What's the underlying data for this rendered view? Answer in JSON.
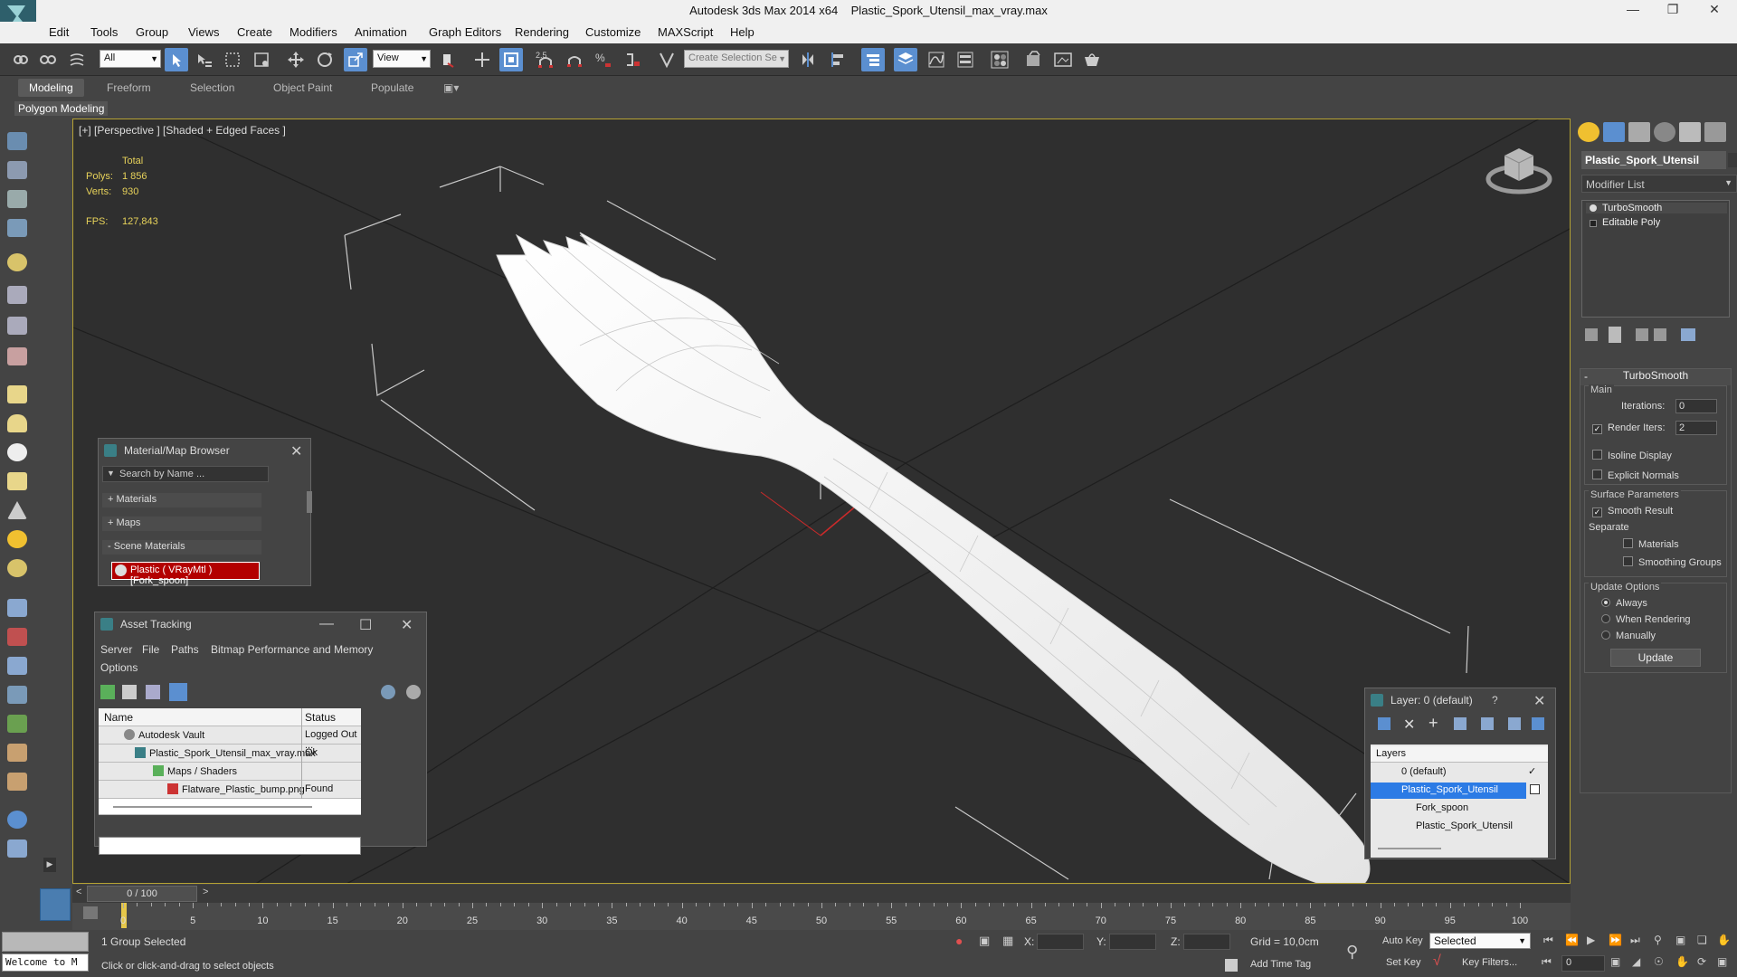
{
  "window": {
    "app_title": "Autodesk 3ds Max  2014 x64",
    "file_title": "Plastic_Spork_Utensil_max_vray.max"
  },
  "menu": [
    "Edit",
    "Tools",
    "Group",
    "Views",
    "Create",
    "Modifiers",
    "Animation",
    "Graph Editors",
    "Rendering",
    "Customize",
    "MAXScript",
    "Help"
  ],
  "toolbar": {
    "selection_filter": "All",
    "reference_coord": "View",
    "snap_label": "2.5",
    "named_selection_placeholder": "Create Selection Se"
  },
  "ribbon": {
    "tabs": [
      "Modeling",
      "Freeform",
      "Selection",
      "Object Paint",
      "Populate"
    ],
    "active_tab": "Modeling",
    "sub_label": "Polygon Modeling"
  },
  "viewport": {
    "label": "[+] [Perspective ] [Shaded + Edged Faces ]",
    "stats": {
      "header": "Total",
      "polys_label": "Polys:",
      "polys_value": "1 856",
      "verts_label": "Verts:",
      "verts_value": "930",
      "fps_label": "FPS:",
      "fps_value": "127,843"
    }
  },
  "command_panel": {
    "object_name": "Plastic_Spork_Utensil",
    "modifier_list_label": "Modifier List",
    "stack": [
      "TurboSmooth",
      "Editable Poly"
    ],
    "turbosmooth": {
      "title": "TurboSmooth",
      "main_label": "Main",
      "iterations_label": "Iterations:",
      "iterations_value": "0",
      "render_iters_label": "Render Iters:",
      "render_iters_value": "2",
      "render_iters_checked": true,
      "isoline_label": "Isoline Display",
      "explicit_normals_label": "Explicit Normals",
      "surface_params_label": "Surface Parameters",
      "smooth_result_label": "Smooth Result",
      "smooth_result_checked": true,
      "separate_label": "Separate",
      "materials_label": "Materials",
      "smoothing_groups_label": "Smoothing Groups",
      "update_options_label": "Update Options",
      "always_label": "Always",
      "when_rendering_label": "When Rendering",
      "manually_label": "Manually",
      "selected_update_option": "Always",
      "update_button": "Update"
    }
  },
  "material_browser": {
    "title": "Material/Map Browser",
    "search_placeholder": "Search by Name ...",
    "sections": [
      "+ Materials",
      "+ Maps",
      "- Scene Materials"
    ],
    "scene_material": "Plastic  ( VRayMtl )  [Fork_spoon]"
  },
  "asset_tracking": {
    "title": "Asset Tracking",
    "menu": [
      "Server",
      "File",
      "Paths",
      "Bitmap Performance and Memory",
      "Options"
    ],
    "col_name": "Name",
    "col_status": "Status",
    "rows": [
      {
        "name": "Autodesk Vault",
        "status": "Logged Out ..."
      },
      {
        "name": "Plastic_Spork_Utensil_max_vray.max",
        "status": "Ok"
      },
      {
        "name": "Maps / Shaders",
        "status": ""
      },
      {
        "name": "Flatware_Plastic_bump.png",
        "status": "Found"
      }
    ]
  },
  "layer_explorer": {
    "title": "Layer: 0 (default)",
    "help": "?",
    "column_label": "Layers",
    "rows": [
      "0 (default)",
      "Plastic_Spork_Utensil",
      "Fork_spoon",
      "Plastic_Spork_Utensil"
    ],
    "selected_row": 1
  },
  "timeline": {
    "frame_display": "0 / 100",
    "prev": "<",
    "next": ">",
    "ticks": [
      "0",
      "5",
      "10",
      "15",
      "20",
      "25",
      "30",
      "35",
      "40",
      "45",
      "50",
      "55",
      "60",
      "65",
      "70",
      "75",
      "80",
      "85",
      "90",
      "95",
      "100"
    ]
  },
  "status": {
    "maxscript_text": "Welcome to M",
    "selection_info": "1 Group Selected",
    "prompt": "Click or click-and-drag to select objects",
    "x_label": "X:",
    "y_label": "Y:",
    "z_label": "Z:",
    "grid": "Grid = 10,0cm",
    "add_time_tag": "Add Time Tag",
    "auto_key": "Auto Key",
    "set_key": "Set Key",
    "selected_dropdown": "Selected",
    "key_filters": "Key Filters...",
    "frame_field": "0"
  },
  "colors": {
    "accent_blue": "#5b8fd0",
    "viewport_border": "#b5a233",
    "stat_yellow": "#e7d25a",
    "material_red": "#b30000",
    "layer_select": "#2c7be5"
  }
}
